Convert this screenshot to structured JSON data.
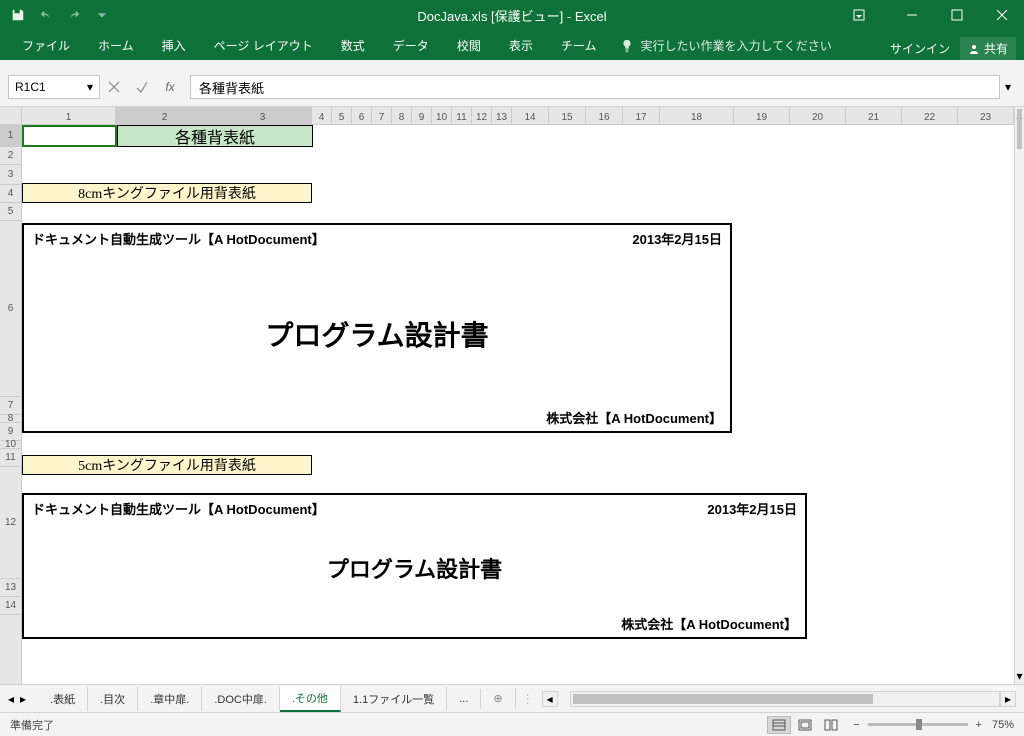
{
  "titlebar": {
    "title": "DocJava.xls  [保護ビュー] - Excel"
  },
  "ribbon": {
    "tabs": [
      "ファイル",
      "ホーム",
      "挿入",
      "ページ レイアウト",
      "数式",
      "データ",
      "校閲",
      "表示",
      "チーム"
    ],
    "tellme": "実行したい作業を入力してください",
    "signin": "サインイン",
    "share": "共有"
  },
  "formulabar": {
    "namebox": "R1C1",
    "value": "各種背表紙"
  },
  "columns": [
    "1",
    "2",
    "3",
    "4",
    "5",
    "6",
    "7",
    "8",
    "9",
    "10",
    "11",
    "12",
    "13",
    "14",
    "15",
    "16",
    "17",
    "18",
    "19",
    "20",
    "21",
    "22",
    "23"
  ],
  "rows_left": [
    "1",
    "2",
    "3",
    "4",
    "5",
    "6",
    "7",
    "8",
    "9",
    "10",
    "11",
    "12",
    "13",
    "14"
  ],
  "content": {
    "page_title": "各種背表紙",
    "section_a": "8cmキングファイル用背表紙",
    "section_b": "5cmキングファイル用背表紙",
    "doc": {
      "tool": "ドキュメント自動生成ツール【A HotDocument】",
      "date": "2013年2月15日",
      "big": "プログラム設計書",
      "company": "株式会社【A HotDocument】"
    }
  },
  "tabs": {
    "items": [
      ".表紙",
      ".目次",
      ".章中扉.",
      ".DOC中扉.",
      ".その他",
      "1.1ファイル一覧",
      "..."
    ],
    "active_index": 4,
    "add": "⊕"
  },
  "status": {
    "left": "準備完了",
    "zoom": "75%"
  }
}
